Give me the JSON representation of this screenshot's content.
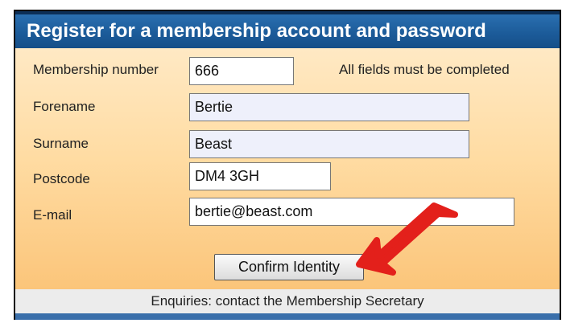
{
  "header": {
    "title": "Register for a membership account and password"
  },
  "form": {
    "membership_label": "Membership number",
    "membership_value": "666",
    "required_note": "All fields must be completed",
    "forename_label": "Forename",
    "forename_value": "Bertie",
    "surname_label": "Surname",
    "surname_value": "Beast",
    "postcode_label": "Postcode",
    "postcode_value": "DM4 3GH",
    "email_label": "E-mail",
    "email_value": "bertie@beast.com",
    "confirm_label": "Confirm Identity"
  },
  "footer": {
    "enquiries": "Enquiries: contact the Membership Secretary"
  },
  "colors": {
    "header": "#1b5a98",
    "form_bg": "#ffdca3",
    "arrow": "#e3201b",
    "readonly_bg": "#eef0fb"
  }
}
